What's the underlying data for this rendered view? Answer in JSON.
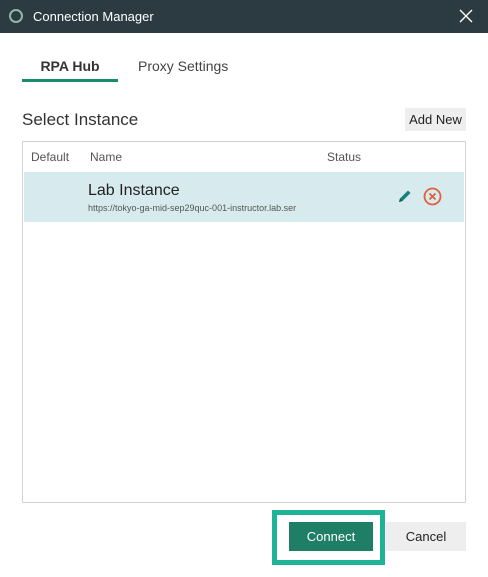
{
  "window": {
    "title": "Connection Manager",
    "close_icon": "close-icon"
  },
  "tabs": [
    {
      "label": "RPA Hub",
      "active": true
    },
    {
      "label": "Proxy Settings",
      "active": false
    }
  ],
  "section": {
    "title": "Select Instance",
    "add_new_label": "Add New"
  },
  "table": {
    "columns": [
      "Default",
      "Name",
      "Status"
    ],
    "rows": [
      {
        "name": "Lab Instance",
        "url": "https://tokyo-ga-mid-sep29quc-001-instructor.lab.ser",
        "selected": true,
        "actions": [
          "edit-icon",
          "delete-icon"
        ]
      }
    ]
  },
  "footer": {
    "connect_label": "Connect",
    "cancel_label": "Cancel"
  },
  "colors": {
    "titlebar": "#2c3a42",
    "accent": "#1b8a6b",
    "selected_row": "#d7ebef",
    "delete": "#e0603c",
    "highlight": "#1eb396"
  }
}
